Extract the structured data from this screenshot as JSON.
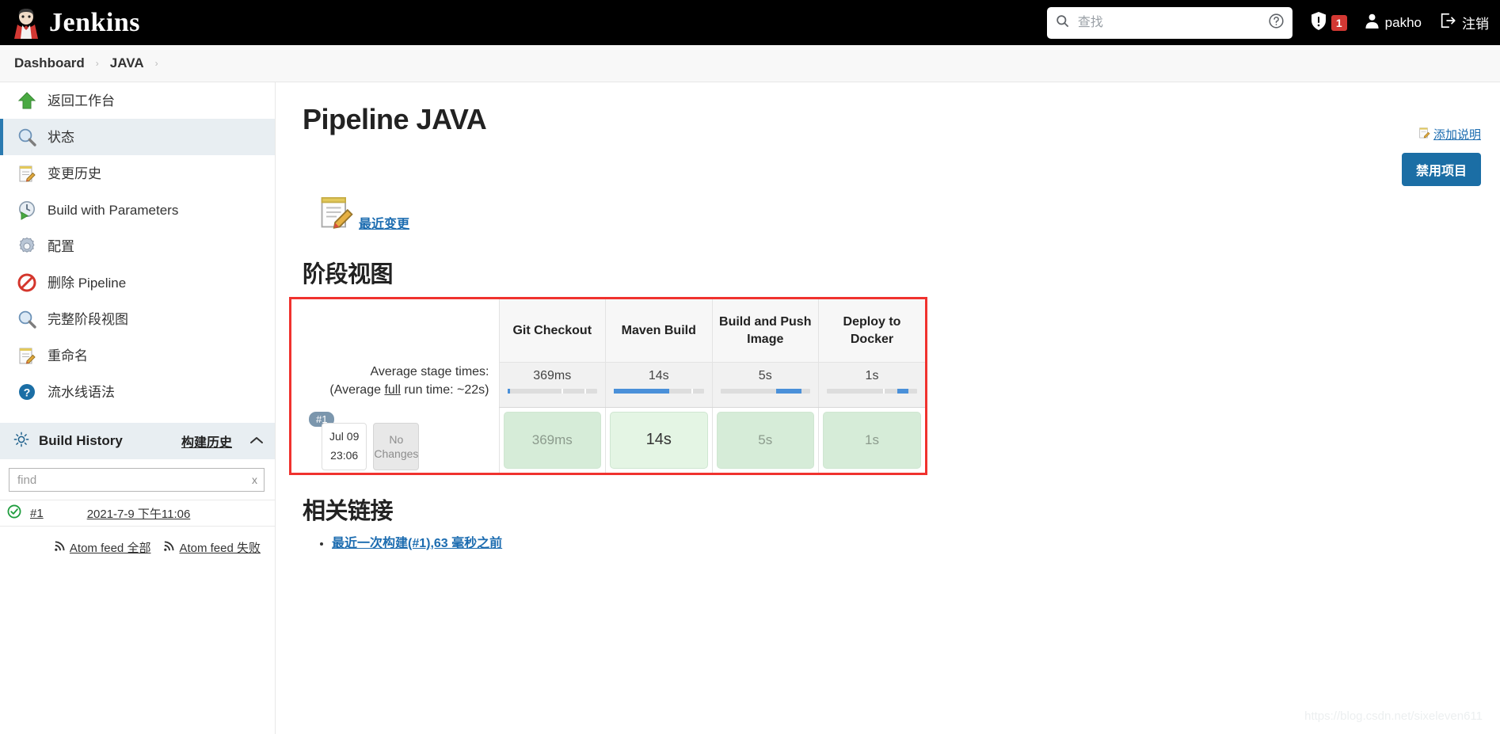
{
  "header": {
    "brand": "Jenkins",
    "logo_icon": "jenkins-butler-logo",
    "search": {
      "placeholder": "查找",
      "value": "",
      "icon": "search-icon",
      "help_icon": "help-circle-icon"
    },
    "security": {
      "icon": "shield-warning-icon",
      "count": "1"
    },
    "user": {
      "icon": "person-icon",
      "name": "pakho"
    },
    "logout": {
      "icon": "logout-icon",
      "label": "注销"
    }
  },
  "breadcrumb": {
    "items": [
      "Dashboard",
      "JAVA"
    ],
    "separator": "›"
  },
  "sidebar": {
    "items": [
      {
        "label": "返回工作台",
        "icon": "up-arrow-green-icon",
        "active": false
      },
      {
        "label": "状态",
        "icon": "magnifier-icon",
        "active": true
      },
      {
        "label": "变更历史",
        "icon": "notepad-pencil-icon",
        "active": false
      },
      {
        "label": "Build with Parameters",
        "icon": "clock-play-icon",
        "active": false
      },
      {
        "label": "配置",
        "icon": "gear-icon",
        "active": false
      },
      {
        "label": "删除 Pipeline",
        "icon": "no-entry-icon",
        "active": false
      },
      {
        "label": "完整阶段视图",
        "icon": "magnifier-icon",
        "active": false
      },
      {
        "label": "重命名",
        "icon": "notepad-pencil-icon",
        "active": false
      },
      {
        "label": "流水线语法",
        "icon": "question-circle-icon",
        "active": false
      }
    ],
    "build_history": {
      "icon": "build-history-icon",
      "title": "Build History",
      "link_label": "构建历史",
      "collapse_icon": "chevron-up-icon",
      "find": {
        "placeholder": "find",
        "value": "",
        "clear_label": "x"
      },
      "builds": [
        {
          "status_icon": "success-check-icon",
          "number": "#1",
          "timestamp": "2021-7-9 下午11:06"
        }
      ],
      "feeds": [
        {
          "icon": "rss-icon",
          "label": "Atom feed 全部"
        },
        {
          "icon": "rss-icon",
          "label": "Atom feed 失败"
        }
      ]
    }
  },
  "main": {
    "page_title": "Pipeline JAVA",
    "add_description": {
      "icon": "notepad-pencil-icon",
      "label": "添加说明"
    },
    "disable_button": "禁用项目",
    "recent_changes": {
      "icon": "notepad-pencil-icon",
      "label": "最近变更"
    },
    "stage_view": {
      "title": "阶段视图",
      "average_label_line1": "Average stage times:",
      "average_label_line2_pre": "(Average ",
      "average_label_line2_underline": "full",
      "average_label_line2_post": " run time: ~22s)",
      "stages": [
        "Git Checkout",
        "Maven Build",
        "Build and Push Image",
        "Deploy to Docker"
      ],
      "average_times": [
        "369ms",
        "14s",
        "5s",
        "1s"
      ],
      "bar_fill_start_pct": [
        0,
        0,
        62,
        78
      ],
      "bar_fill_width_pct": [
        3,
        62,
        28,
        12
      ],
      "runs": [
        {
          "badge": "#1",
          "date_line1": "Jul 09",
          "date_line2": "23:06",
          "changes_label_line1": "No",
          "changes_label_line2": "Changes",
          "cells": [
            "369ms",
            "14s",
            "5s",
            "1s"
          ],
          "cell_emphasis": [
            false,
            true,
            false,
            false
          ]
        }
      ]
    },
    "related_links": {
      "title": "相关链接",
      "items": [
        {
          "link_text": "最近一次构建(#1),63 毫秒之前"
        }
      ]
    }
  },
  "watermark": "https://blog.csdn.net/sixeleven611",
  "colors": {
    "accent_blue": "#1b6ea5",
    "alert_red": "#d33833",
    "highlight_red": "#f0322e",
    "success_green": "#d6ecd8",
    "progress_blue": "#4a90d9"
  }
}
